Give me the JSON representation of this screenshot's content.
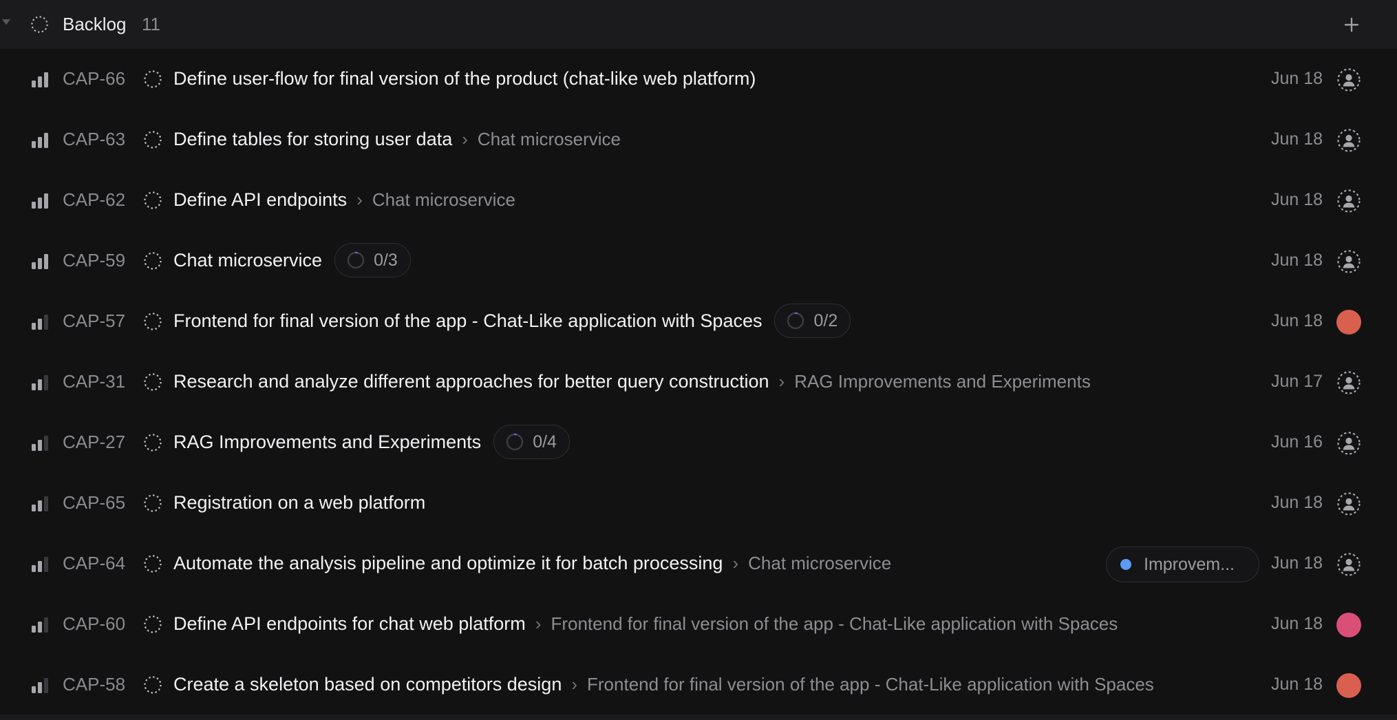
{
  "group": {
    "title": "Backlog",
    "count": "11",
    "add_icon": "plus-icon"
  },
  "colors": {
    "avatar_red": "#d9604f",
    "avatar_pink": "#d94f78",
    "label_blue": "#5b9bf2",
    "progress_accent": "#6b5ce7"
  },
  "issues": [
    {
      "id": "CAP-66",
      "title": "Define user-flow for final version of the product (chat-like web platform)",
      "parent": "",
      "progress": "",
      "label": "",
      "date": "Jun 18",
      "assignee": "unassigned",
      "priority": "high"
    },
    {
      "id": "CAP-63",
      "title": "Define tables for storing user data",
      "parent": "Chat microservice",
      "progress": "",
      "label": "",
      "date": "Jun 18",
      "assignee": "unassigned",
      "priority": "high"
    },
    {
      "id": "CAP-62",
      "title": "Define API endpoints",
      "parent": "Chat microservice",
      "progress": "",
      "label": "",
      "date": "Jun 18",
      "assignee": "unassigned",
      "priority": "high"
    },
    {
      "id": "CAP-59",
      "title": "Chat microservice",
      "parent": "",
      "progress": "0/3",
      "label": "",
      "date": "Jun 18",
      "assignee": "unassigned",
      "priority": "high"
    },
    {
      "id": "CAP-57",
      "title": "Frontend for final version of the app - Chat-Like application with Spaces",
      "parent": "",
      "progress": "0/2",
      "label": "",
      "date": "Jun 18",
      "assignee": "red",
      "priority": "medium"
    },
    {
      "id": "CAP-31",
      "title": "Research and analyze different approaches for better query construction",
      "parent": "RAG Improvements and Experiments",
      "progress": "",
      "label": "",
      "date": "Jun 17",
      "assignee": "unassigned",
      "priority": "medium"
    },
    {
      "id": "CAP-27",
      "title": "RAG Improvements and Experiments",
      "parent": "",
      "progress": "0/4",
      "label": "",
      "date": "Jun 16",
      "assignee": "unassigned",
      "priority": "medium"
    },
    {
      "id": "CAP-65",
      "title": "Registration on a web platform",
      "parent": "",
      "progress": "",
      "label": "",
      "date": "Jun 18",
      "assignee": "unassigned",
      "priority": "medium"
    },
    {
      "id": "CAP-64",
      "title": "Automate the analysis pipeline and optimize it for batch processing",
      "parent": "Chat microservice",
      "progress": "",
      "label": "Improvem...",
      "date": "Jun 18",
      "assignee": "unassigned",
      "priority": "medium"
    },
    {
      "id": "CAP-60",
      "title": "Define API endpoints for chat web platform",
      "parent": "Frontend for final version of the app - Chat-Like application with Spaces",
      "progress": "",
      "label": "",
      "date": "Jun 18",
      "assignee": "pink",
      "priority": "medium"
    },
    {
      "id": "CAP-58",
      "title": "Create a skeleton based on competitors design",
      "parent": "Frontend for final version of the app - Chat-Like application with Spaces",
      "progress": "",
      "label": "",
      "date": "Jun 18",
      "assignee": "red",
      "priority": "medium"
    }
  ]
}
